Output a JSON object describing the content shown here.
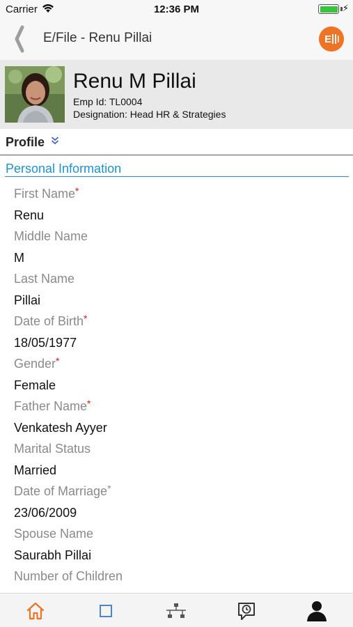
{
  "status_bar": {
    "carrier": "Carrier",
    "time": "12:36 PM",
    "battery_charging_icon": "bolt-icon"
  },
  "nav": {
    "back_icon": "chevron-left-icon",
    "title": "E/File - Renu Pillai",
    "action_label": "E",
    "action_color": "#ee7324"
  },
  "employee": {
    "name": "Renu M Pillai",
    "emp_id": "Emp Id: TL0004",
    "designation": "Designation: Head HR & Strategies"
  },
  "profile": {
    "label": "Profile",
    "toggle_icon": "double-chevron-down-icon"
  },
  "section": {
    "title": "Personal Information",
    "accent_color": "#1a93d0"
  },
  "fields": [
    {
      "label": "First Name",
      "required": "*",
      "value": "Renu"
    },
    {
      "label": "Middle Name",
      "required": "",
      "value": "M"
    },
    {
      "label": "Last Name",
      "required": "",
      "value": "Pillai"
    },
    {
      "label": "Date of Birth",
      "required": "*",
      "value": "18/05/1977"
    },
    {
      "label": "Gender",
      "required": "*",
      "value": "Female"
    },
    {
      "label": "Father Name",
      "required": "*",
      "value": "Venkatesh Ayyer"
    },
    {
      "label": "Marital Status",
      "required": "",
      "value": "Married"
    },
    {
      "label": "Date of Marriage",
      "required": "*",
      "value": "23/06/2009"
    },
    {
      "label": "Spouse Name",
      "required": "",
      "value": "Saurabh Pillai"
    },
    {
      "label": "Number of Children",
      "required": "",
      "value": ""
    }
  ],
  "tabs": [
    {
      "icon": "home-icon",
      "active": true
    },
    {
      "icon": "square-icon",
      "active": false
    },
    {
      "icon": "org-chart-icon",
      "active": false
    },
    {
      "icon": "timesheet-icon",
      "active": false
    },
    {
      "icon": "user-icon",
      "active": false
    }
  ]
}
